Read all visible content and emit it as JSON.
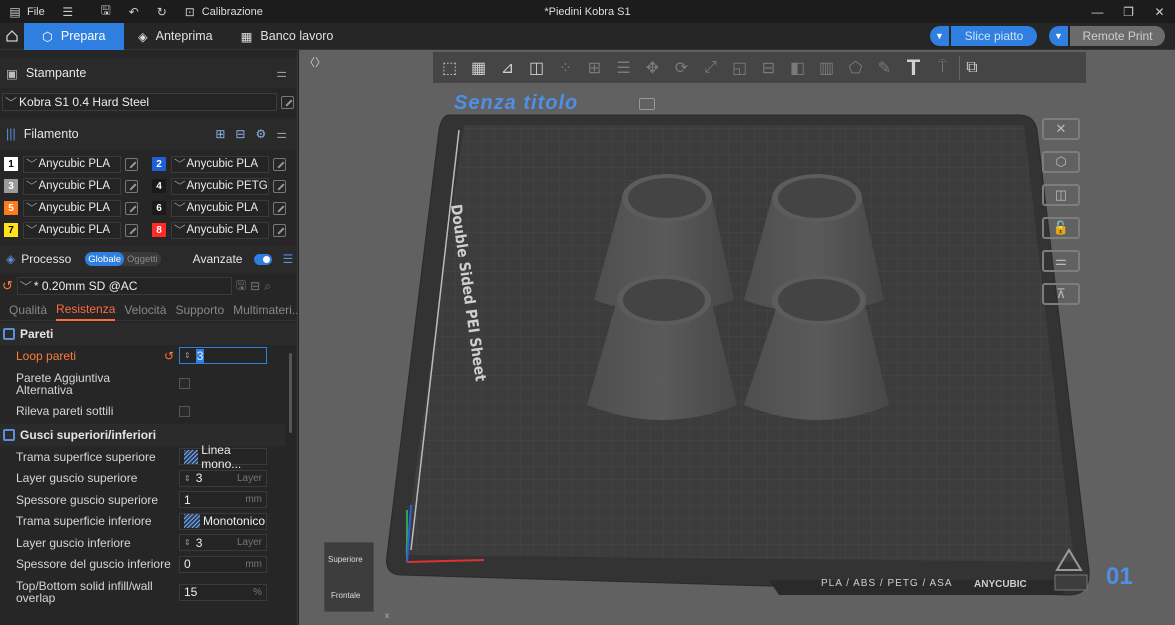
{
  "titlebar": {
    "file_label": "File",
    "calibration_label": "Calibrazione",
    "window_title": "*Piedini Kobra S1"
  },
  "topbar": {
    "tabs": [
      {
        "label": "Prepara",
        "icon": "cube-icon"
      },
      {
        "label": "Anteprima",
        "icon": "layers-icon"
      },
      {
        "label": "Banco lavoro",
        "icon": "grid-icon"
      }
    ],
    "slice_label": "Slice piatto",
    "remote_label": "Remote Print"
  },
  "printer": {
    "section_label": "Stampante",
    "name": "Kobra S1 0.4 Hard Steel"
  },
  "filament": {
    "section_label": "Filamento",
    "slots": [
      {
        "num": "1",
        "name": "Anycubic PLA",
        "color": "#ffffff",
        "text": "#000000"
      },
      {
        "num": "2",
        "name": "Anycubic PLA",
        "color": "#1f5fd6",
        "text": "#ffffff"
      },
      {
        "num": "3",
        "name": "Anycubic PLA",
        "color": "#9a9a9a",
        "text": "#ffffff"
      },
      {
        "num": "4",
        "name": "Anycubic PETG",
        "color": "#1a1a1a",
        "text": "#ffffff"
      },
      {
        "num": "5",
        "name": "Anycubic PLA",
        "color": "#ff7a1a",
        "text": "#ffffff"
      },
      {
        "num": "6",
        "name": "Anycubic PLA",
        "color": "#1a1a1a",
        "text": "#ffffff"
      },
      {
        "num": "7",
        "name": "Anycubic PLA",
        "color": "#ffe21a",
        "text": "#000000"
      },
      {
        "num": "8",
        "name": "Anycubic PLA",
        "color": "#ff2a2a",
        "text": "#ffffff"
      }
    ]
  },
  "process": {
    "section_label": "Processo",
    "seg_global": "Globale",
    "seg_objects": "Oggetti",
    "advanced_label": "Avanzate",
    "preset": "* 0.20mm SD @AC",
    "subtabs": [
      "Qualità",
      "Resistenza",
      "Velocità",
      "Supporto",
      "Multimateri..."
    ],
    "walls_group": "Pareti",
    "loop_walls": {
      "label": "Loop pareti",
      "value": "3"
    },
    "extra_wall": "Parete Aggiuntiva Alternativa",
    "thin_walls": "Rileva pareti sottili",
    "shells_group": "Gusci superiori/inferiori",
    "rows": [
      {
        "label": "Trama superfice superiore",
        "value": "Linea mono...",
        "unit": ""
      },
      {
        "label": "Layer guscio superiore",
        "value": "3",
        "unit": "Layer"
      },
      {
        "label": "Spessore guscio superiore",
        "value": "1",
        "unit": "mm"
      },
      {
        "label": "Trama superficie inferiore",
        "value": "Monotonico",
        "unit": ""
      },
      {
        "label": "Layer guscio inferiore",
        "value": "3",
        "unit": "Layer"
      },
      {
        "label": "Spessore del guscio inferiore",
        "value": "0",
        "unit": "mm"
      },
      {
        "label": "Top/Bottom solid infill/wall overlap",
        "value": "15",
        "unit": "%"
      }
    ]
  },
  "viewport": {
    "plate_title": "Senza titolo",
    "sheet_label": "Double Sided PEI Sheet",
    "plate_footer": "PLA / ABS / PETG / ASA",
    "brand": "ANYCUBIC",
    "plate_number": "01",
    "view_top": "Superiore",
    "view_front": "Frontale",
    "axis_x": "x"
  }
}
